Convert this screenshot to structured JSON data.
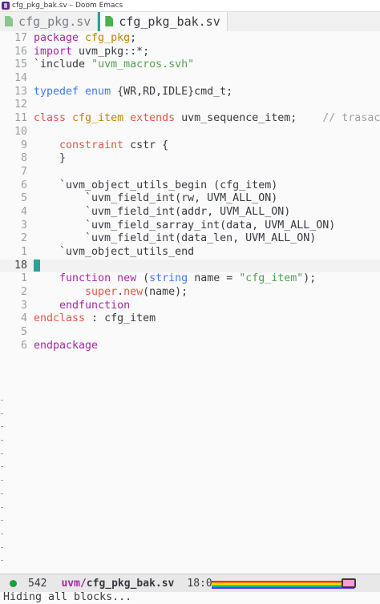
{
  "window": {
    "title": "cfg_pkg_bak.sv – Doom Emacs",
    "icon": "emacs-icon"
  },
  "tabs": [
    {
      "label": "cfg_pkg.sv",
      "active": false,
      "icon": "verilog-file-icon"
    },
    {
      "label": "cfg_pkg_bak.sv",
      "active": true,
      "icon": "verilog-file-icon"
    }
  ],
  "colors": {
    "accent": "#2aa198",
    "keyword": "#a626a4",
    "type": "#e45649",
    "string": "#50a14f",
    "builtin": "#4078f2",
    "class": "#c18401",
    "status_ok": "#1a9f3c"
  },
  "editor": {
    "lines": [
      {
        "ln": "17",
        "tokens": [
          [
            "keyword",
            "package "
          ],
          [
            "class",
            "cfg_pkg"
          ],
          [
            "plain",
            ";"
          ]
        ]
      },
      {
        "ln": "16",
        "tokens": [
          [
            "keyword",
            "import "
          ],
          [
            "plain",
            "uvm_pkg::*;"
          ]
        ]
      },
      {
        "ln": "15",
        "tokens": [
          [
            "plain",
            "`include "
          ],
          [
            "string",
            "\"uvm_macros.svh\""
          ]
        ]
      },
      {
        "ln": "14",
        "tokens": []
      },
      {
        "ln": "13",
        "tokens": [
          [
            "builtin",
            "typedef "
          ],
          [
            "builtin",
            "enum "
          ],
          [
            "plain",
            "{WR,RD,IDLE}cmd_t;"
          ]
        ]
      },
      {
        "ln": "12",
        "tokens": []
      },
      {
        "ln": "11",
        "tokens": [
          [
            "type",
            "class "
          ],
          [
            "class",
            "cfg_item "
          ],
          [
            "type",
            "extends "
          ],
          [
            "plain",
            "uvm_sequence_item;    "
          ],
          [
            "comment",
            "// trasaction"
          ]
        ]
      },
      {
        "ln": "10",
        "tokens": []
      },
      {
        "ln": "9",
        "tokens": [
          [
            "plain",
            "    "
          ],
          [
            "type",
            "constraint "
          ],
          [
            "plain",
            "cstr {"
          ]
        ]
      },
      {
        "ln": "8",
        "tokens": [
          [
            "plain",
            "    }"
          ]
        ]
      },
      {
        "ln": "7",
        "tokens": []
      },
      {
        "ln": "6",
        "tokens": [
          [
            "plain",
            "    `uvm_object_utils_begin (cfg_item)"
          ]
        ]
      },
      {
        "ln": "5",
        "tokens": [
          [
            "plain",
            "        `uvm_field_int(rw, UVM_ALL_ON)"
          ]
        ]
      },
      {
        "ln": "4",
        "tokens": [
          [
            "plain",
            "        `uvm_field_int(addr, UVM_ALL_ON)"
          ]
        ]
      },
      {
        "ln": "3",
        "tokens": [
          [
            "plain",
            "        `uvm_field_sarray_int(data, UVM_ALL_ON)"
          ]
        ]
      },
      {
        "ln": "2",
        "tokens": [
          [
            "plain",
            "        `uvm_field_int(data_len, UVM_ALL_ON)"
          ]
        ]
      },
      {
        "ln": "1",
        "tokens": [
          [
            "plain",
            "    `uvm_object_utils_end"
          ]
        ]
      },
      {
        "ln": "18",
        "current": true,
        "tokens": []
      },
      {
        "ln": "1",
        "tokens": [
          [
            "plain",
            "    "
          ],
          [
            "keyword",
            "function "
          ],
          [
            "keyword",
            "new "
          ],
          [
            "plain",
            "("
          ],
          [
            "builtin",
            "string "
          ],
          [
            "plain",
            "name = "
          ],
          [
            "string",
            "\"cfg_item\""
          ],
          [
            "plain",
            ");"
          ]
        ]
      },
      {
        "ln": "2",
        "tokens": [
          [
            "plain",
            "        "
          ],
          [
            "type",
            "super"
          ],
          [
            "plain",
            "."
          ],
          [
            "type",
            "new"
          ],
          [
            "plain",
            "(name);"
          ]
        ]
      },
      {
        "ln": "3",
        "tokens": [
          [
            "plain",
            "    "
          ],
          [
            "keyword",
            "endfunction"
          ]
        ]
      },
      {
        "ln": "4",
        "tokens": [
          [
            "type",
            "endclass "
          ],
          [
            "plain",
            ": cfg_item"
          ]
        ]
      },
      {
        "ln": "5",
        "tokens": []
      },
      {
        "ln": "6",
        "tokens": [
          [
            "keyword",
            "endpackage"
          ]
        ]
      }
    ],
    "empty_line_markers": 16
  },
  "modeline": {
    "status_icon": "status-dot-icon",
    "size": "542",
    "dir": "uvm/",
    "file": "cfg_pkg_bak.sv",
    "position": "18:0",
    "progress_icon": "nyan-cat-icon"
  },
  "echo_area": {
    "message": "Hiding all blocks..."
  }
}
